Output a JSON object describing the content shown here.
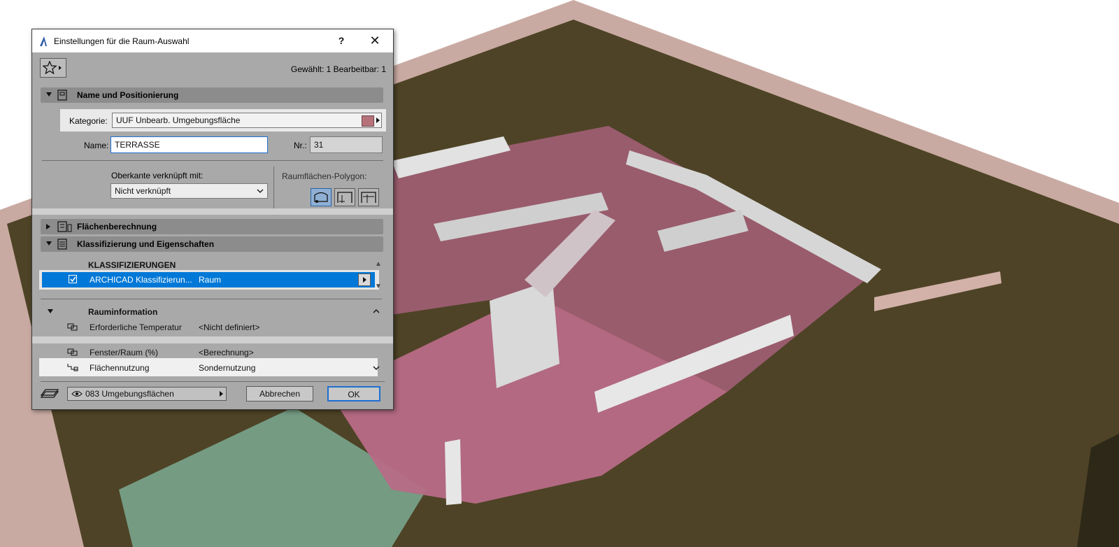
{
  "dialog": {
    "title": "Einstellungen für die Raum-Auswahl",
    "help_label": "?",
    "close_label": "✕",
    "selection_info": "Gewählt: 1 Bearbeitbar: 1"
  },
  "sections": {
    "name_pos": "Name und Positionierung",
    "area_calc": "Flächenberechnung",
    "classification": "Klassifizierung und Eigenschaften"
  },
  "name_pos": {
    "kategorie_label": "Kategorie:",
    "kategorie_value": "UUF  Unbearb. Umgebungsfläche",
    "name_label": "Name:",
    "name_value": "TERRASSE",
    "nr_label": "Nr.:",
    "nr_value": "31",
    "oberkante_label": "Oberkante verknüpft mit:",
    "oberkante_value": "Nicht verknüpft",
    "polygon_label": "Raumflächen-Polygon:"
  },
  "classification": {
    "header": "KLASSIFIZIERUNGEN",
    "row_name": "ARCHICAD Klassifizierun...",
    "row_value": "Raum"
  },
  "room_info": {
    "header": "Rauminformation",
    "rows": [
      {
        "name": "Erforderliche Temperatur",
        "value": "<Nicht definiert>"
      },
      {
        "name": "Fenster/Raum (%)",
        "value": "<Berechnung>"
      },
      {
        "name": "Flächennutzung",
        "value": "Sondernutzung"
      }
    ]
  },
  "footer": {
    "layer": "083 Umgebungsflächen",
    "cancel": "Abbrechen",
    "ok": "OK"
  },
  "colors": {
    "accent": "#0078d7",
    "room_fill": "#b6727a",
    "ground": "#4a3f24"
  }
}
